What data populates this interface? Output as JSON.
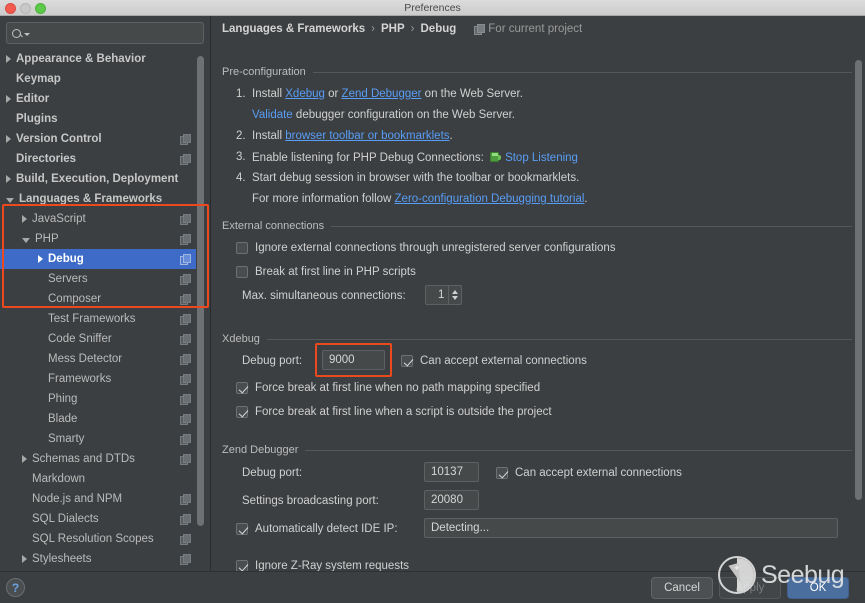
{
  "window": {
    "title": "Preferences",
    "traffic_lights": [
      "close-red",
      "minimize-gray",
      "zoom-green"
    ]
  },
  "sidebar": {
    "search": {
      "value": "",
      "placeholder": ""
    },
    "items": [
      {
        "label": "Appearance & Behavior",
        "indent": 0,
        "twisty": "collapsed",
        "bold": true,
        "copy": false,
        "selected": false
      },
      {
        "label": "Keymap",
        "indent": 0,
        "twisty": "none",
        "bold": true,
        "copy": false,
        "selected": false
      },
      {
        "label": "Editor",
        "indent": 0,
        "twisty": "collapsed",
        "bold": true,
        "copy": false,
        "selected": false
      },
      {
        "label": "Plugins",
        "indent": 0,
        "twisty": "none",
        "bold": true,
        "copy": false,
        "selected": false
      },
      {
        "label": "Version Control",
        "indent": 0,
        "twisty": "collapsed",
        "bold": true,
        "copy": true,
        "selected": false
      },
      {
        "label": "Directories",
        "indent": 0,
        "twisty": "none",
        "bold": true,
        "copy": true,
        "selected": false
      },
      {
        "label": "Build, Execution, Deployment",
        "indent": 0,
        "twisty": "collapsed",
        "bold": true,
        "copy": false,
        "selected": false
      },
      {
        "label": "Languages & Frameworks",
        "indent": 0,
        "twisty": "open",
        "bold": true,
        "copy": false,
        "selected": false
      },
      {
        "label": "JavaScript",
        "indent": 1,
        "twisty": "collapsed",
        "bold": false,
        "copy": true,
        "selected": false
      },
      {
        "label": "PHP",
        "indent": 1,
        "twisty": "open",
        "bold": false,
        "copy": true,
        "selected": false
      },
      {
        "label": "Debug",
        "indent": 2,
        "twisty": "collapsed",
        "bold": true,
        "copy": true,
        "selected": true
      },
      {
        "label": "Servers",
        "indent": 2,
        "twisty": "none",
        "bold": false,
        "copy": true,
        "selected": false
      },
      {
        "label": "Composer",
        "indent": 2,
        "twisty": "none",
        "bold": false,
        "copy": true,
        "selected": false
      },
      {
        "label": "Test Frameworks",
        "indent": 2,
        "twisty": "none",
        "bold": false,
        "copy": true,
        "selected": false
      },
      {
        "label": "Code Sniffer",
        "indent": 2,
        "twisty": "none",
        "bold": false,
        "copy": true,
        "selected": false
      },
      {
        "label": "Mess Detector",
        "indent": 2,
        "twisty": "none",
        "bold": false,
        "copy": true,
        "selected": false
      },
      {
        "label": "Frameworks",
        "indent": 2,
        "twisty": "none",
        "bold": false,
        "copy": true,
        "selected": false
      },
      {
        "label": "Phing",
        "indent": 2,
        "twisty": "none",
        "bold": false,
        "copy": true,
        "selected": false
      },
      {
        "label": "Blade",
        "indent": 2,
        "twisty": "none",
        "bold": false,
        "copy": true,
        "selected": false
      },
      {
        "label": "Smarty",
        "indent": 2,
        "twisty": "none",
        "bold": false,
        "copy": true,
        "selected": false
      },
      {
        "label": "Schemas and DTDs",
        "indent": 1,
        "twisty": "collapsed",
        "bold": false,
        "copy": true,
        "selected": false
      },
      {
        "label": "Markdown",
        "indent": 1,
        "twisty": "none",
        "bold": false,
        "copy": false,
        "selected": false
      },
      {
        "label": "Node.js and NPM",
        "indent": 1,
        "twisty": "none",
        "bold": false,
        "copy": true,
        "selected": false
      },
      {
        "label": "SQL Dialects",
        "indent": 1,
        "twisty": "none",
        "bold": false,
        "copy": true,
        "selected": false
      },
      {
        "label": "SQL Resolution Scopes",
        "indent": 1,
        "twisty": "none",
        "bold": false,
        "copy": true,
        "selected": false
      },
      {
        "label": "Stylesheets",
        "indent": 1,
        "twisty": "collapsed",
        "bold": false,
        "copy": true,
        "selected": false
      }
    ]
  },
  "breadcrumb": {
    "part1": "Languages & Frameworks",
    "sep1": "›",
    "part2": "PHP",
    "sep2": "›",
    "part3": "Debug",
    "scope": "For current project"
  },
  "preconfiguration": {
    "title": "Pre-configuration",
    "step1_num": "1.",
    "step1_a": "Install",
    "step1_link1": "Xdebug",
    "step1_b": "or",
    "step1_link2": "Zend Debugger",
    "step1_c": "on the Web Server.",
    "step1_sub_link": "Validate",
    "step1_sub_text": "debugger configuration on the Web Server.",
    "step2_num": "2.",
    "step2_a": "Install",
    "step2_link": "browser toolbar or bookmarklets",
    "step2_b": ".",
    "step3_num": "3.",
    "step3_a": "Enable listening for PHP Debug Connections:",
    "step3_link": "Stop Listening",
    "step4_num": "4.",
    "step4_a": "Start debug session in browser with the toolbar or bookmarklets.",
    "step4_sub_a": "For more information follow",
    "step4_sub_link": "Zero-configuration Debugging tutorial",
    "step4_sub_b": "."
  },
  "external_connections": {
    "title": "External connections",
    "ignore_unregistered": {
      "label": "Ignore external connections through unregistered server configurations",
      "checked": false
    },
    "break_first_line": {
      "label": "Break at first line in PHP scripts",
      "checked": false
    },
    "max_connections_label": "Max. simultaneous connections:",
    "max_connections_value": "1"
  },
  "xdebug": {
    "title": "Xdebug",
    "debug_port_label": "Debug port:",
    "debug_port_value": "9000",
    "can_accept": {
      "label": "Can accept external connections",
      "checked": true
    },
    "force_no_mapping": {
      "label": "Force break at first line when no path mapping specified",
      "checked": true
    },
    "force_outside_project": {
      "label": "Force break at first line when a script is outside the project",
      "checked": true
    }
  },
  "zend": {
    "title": "Zend Debugger",
    "debug_port_label": "Debug port:",
    "debug_port_value": "10137",
    "can_accept": {
      "label": "Can accept external connections",
      "checked": true
    },
    "broadcast_label": "Settings broadcasting port:",
    "broadcast_value": "20080",
    "auto_detect": {
      "label": "Automatically detect IDE IP:",
      "checked": true
    },
    "auto_detect_value": "Detecting...",
    "ignore_zray": {
      "label": "Ignore Z-Ray system requests",
      "checked": true
    }
  },
  "footer": {
    "help": "?",
    "cancel": "Cancel",
    "apply": "Apply",
    "ok": "OK"
  },
  "watermark": {
    "text": "Seebug"
  },
  "colors": {
    "background": "#3c3f41",
    "selection": "#3d6bc7",
    "link": "#589df6",
    "highlight": "#ec4a1e",
    "primary_button": "#4a6f9e"
  }
}
